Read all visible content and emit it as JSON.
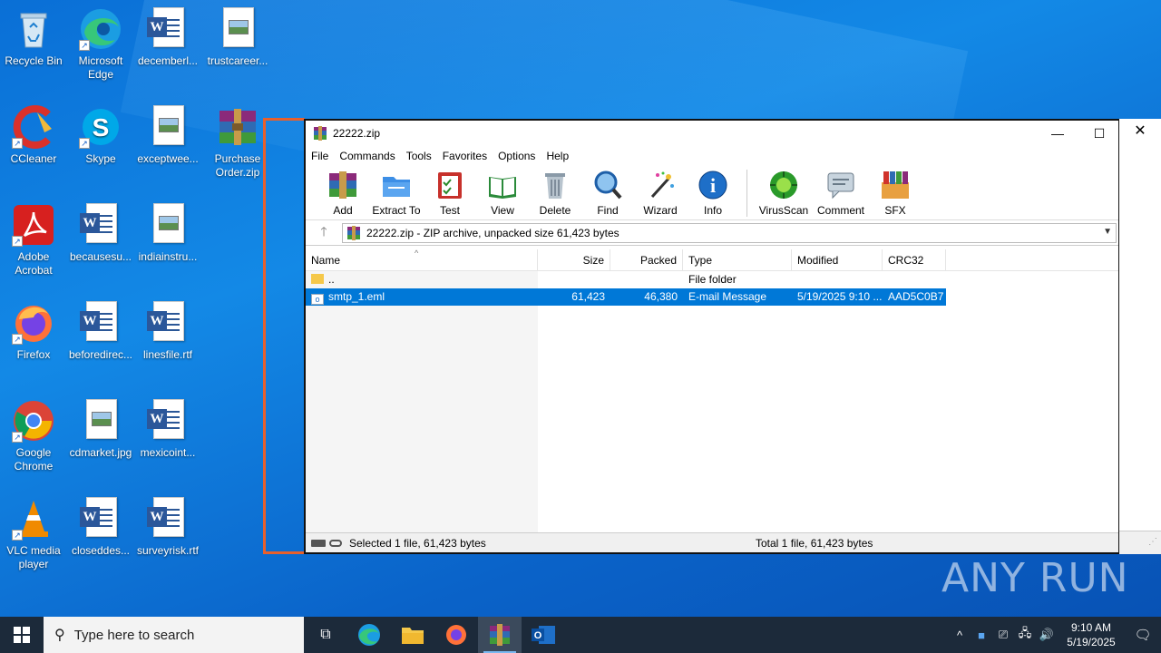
{
  "desktop": {
    "icons": [
      {
        "label": "Recycle Bin"
      },
      {
        "label": "Microsoft Edge"
      },
      {
        "label": "decemberl..."
      },
      {
        "label": "trustcareer..."
      },
      {
        "label": "CCleaner"
      },
      {
        "label": "Skype"
      },
      {
        "label": "exceptwee..."
      },
      {
        "label": "Purchase Order.zip"
      },
      {
        "label": "Adobe Acrobat"
      },
      {
        "label": "becausesu..."
      },
      {
        "label": "indiainstru..."
      },
      {
        "label": "Firefox"
      },
      {
        "label": "beforedirec..."
      },
      {
        "label": "linesfile.rtf"
      },
      {
        "label": "Google Chrome"
      },
      {
        "label": "cdmarket.jpg"
      },
      {
        "label": "mexicoint..."
      },
      {
        "label": "VLC media player"
      },
      {
        "label": "closeddes..."
      },
      {
        "label": "surveyrisk.rtf"
      }
    ]
  },
  "window": {
    "title": "22222.zip",
    "menu": [
      "File",
      "Commands",
      "Tools",
      "Favorites",
      "Options",
      "Help"
    ],
    "toolbar": [
      "Add",
      "Extract To",
      "Test",
      "View",
      "Delete",
      "Find",
      "Wizard",
      "Info",
      "VirusScan",
      "Comment",
      "SFX"
    ],
    "address": "22222.zip - ZIP archive, unpacked size 61,423 bytes",
    "columns": {
      "name": "Name",
      "size": "Size",
      "packed": "Packed",
      "type": "Type",
      "modified": "Modified",
      "crc": "CRC32"
    },
    "rows": [
      {
        "name": "..",
        "size": "",
        "packed": "",
        "type": "File folder",
        "modified": "",
        "crc": ""
      },
      {
        "name": "smtp_1.eml",
        "size": "61,423",
        "packed": "46,380",
        "type": "E-mail Message",
        "modified": "5/19/2025 9:10 ...",
        "crc": "AAD5C0B7"
      }
    ],
    "status_left": "Selected 1 file, 61,423 bytes",
    "status_right": "Total 1 file, 61,423 bytes"
  },
  "taskbar": {
    "search_placeholder": "Type here to search",
    "time": "9:10 AM",
    "date": "5/19/2025"
  },
  "watermark": "ANY RUN"
}
